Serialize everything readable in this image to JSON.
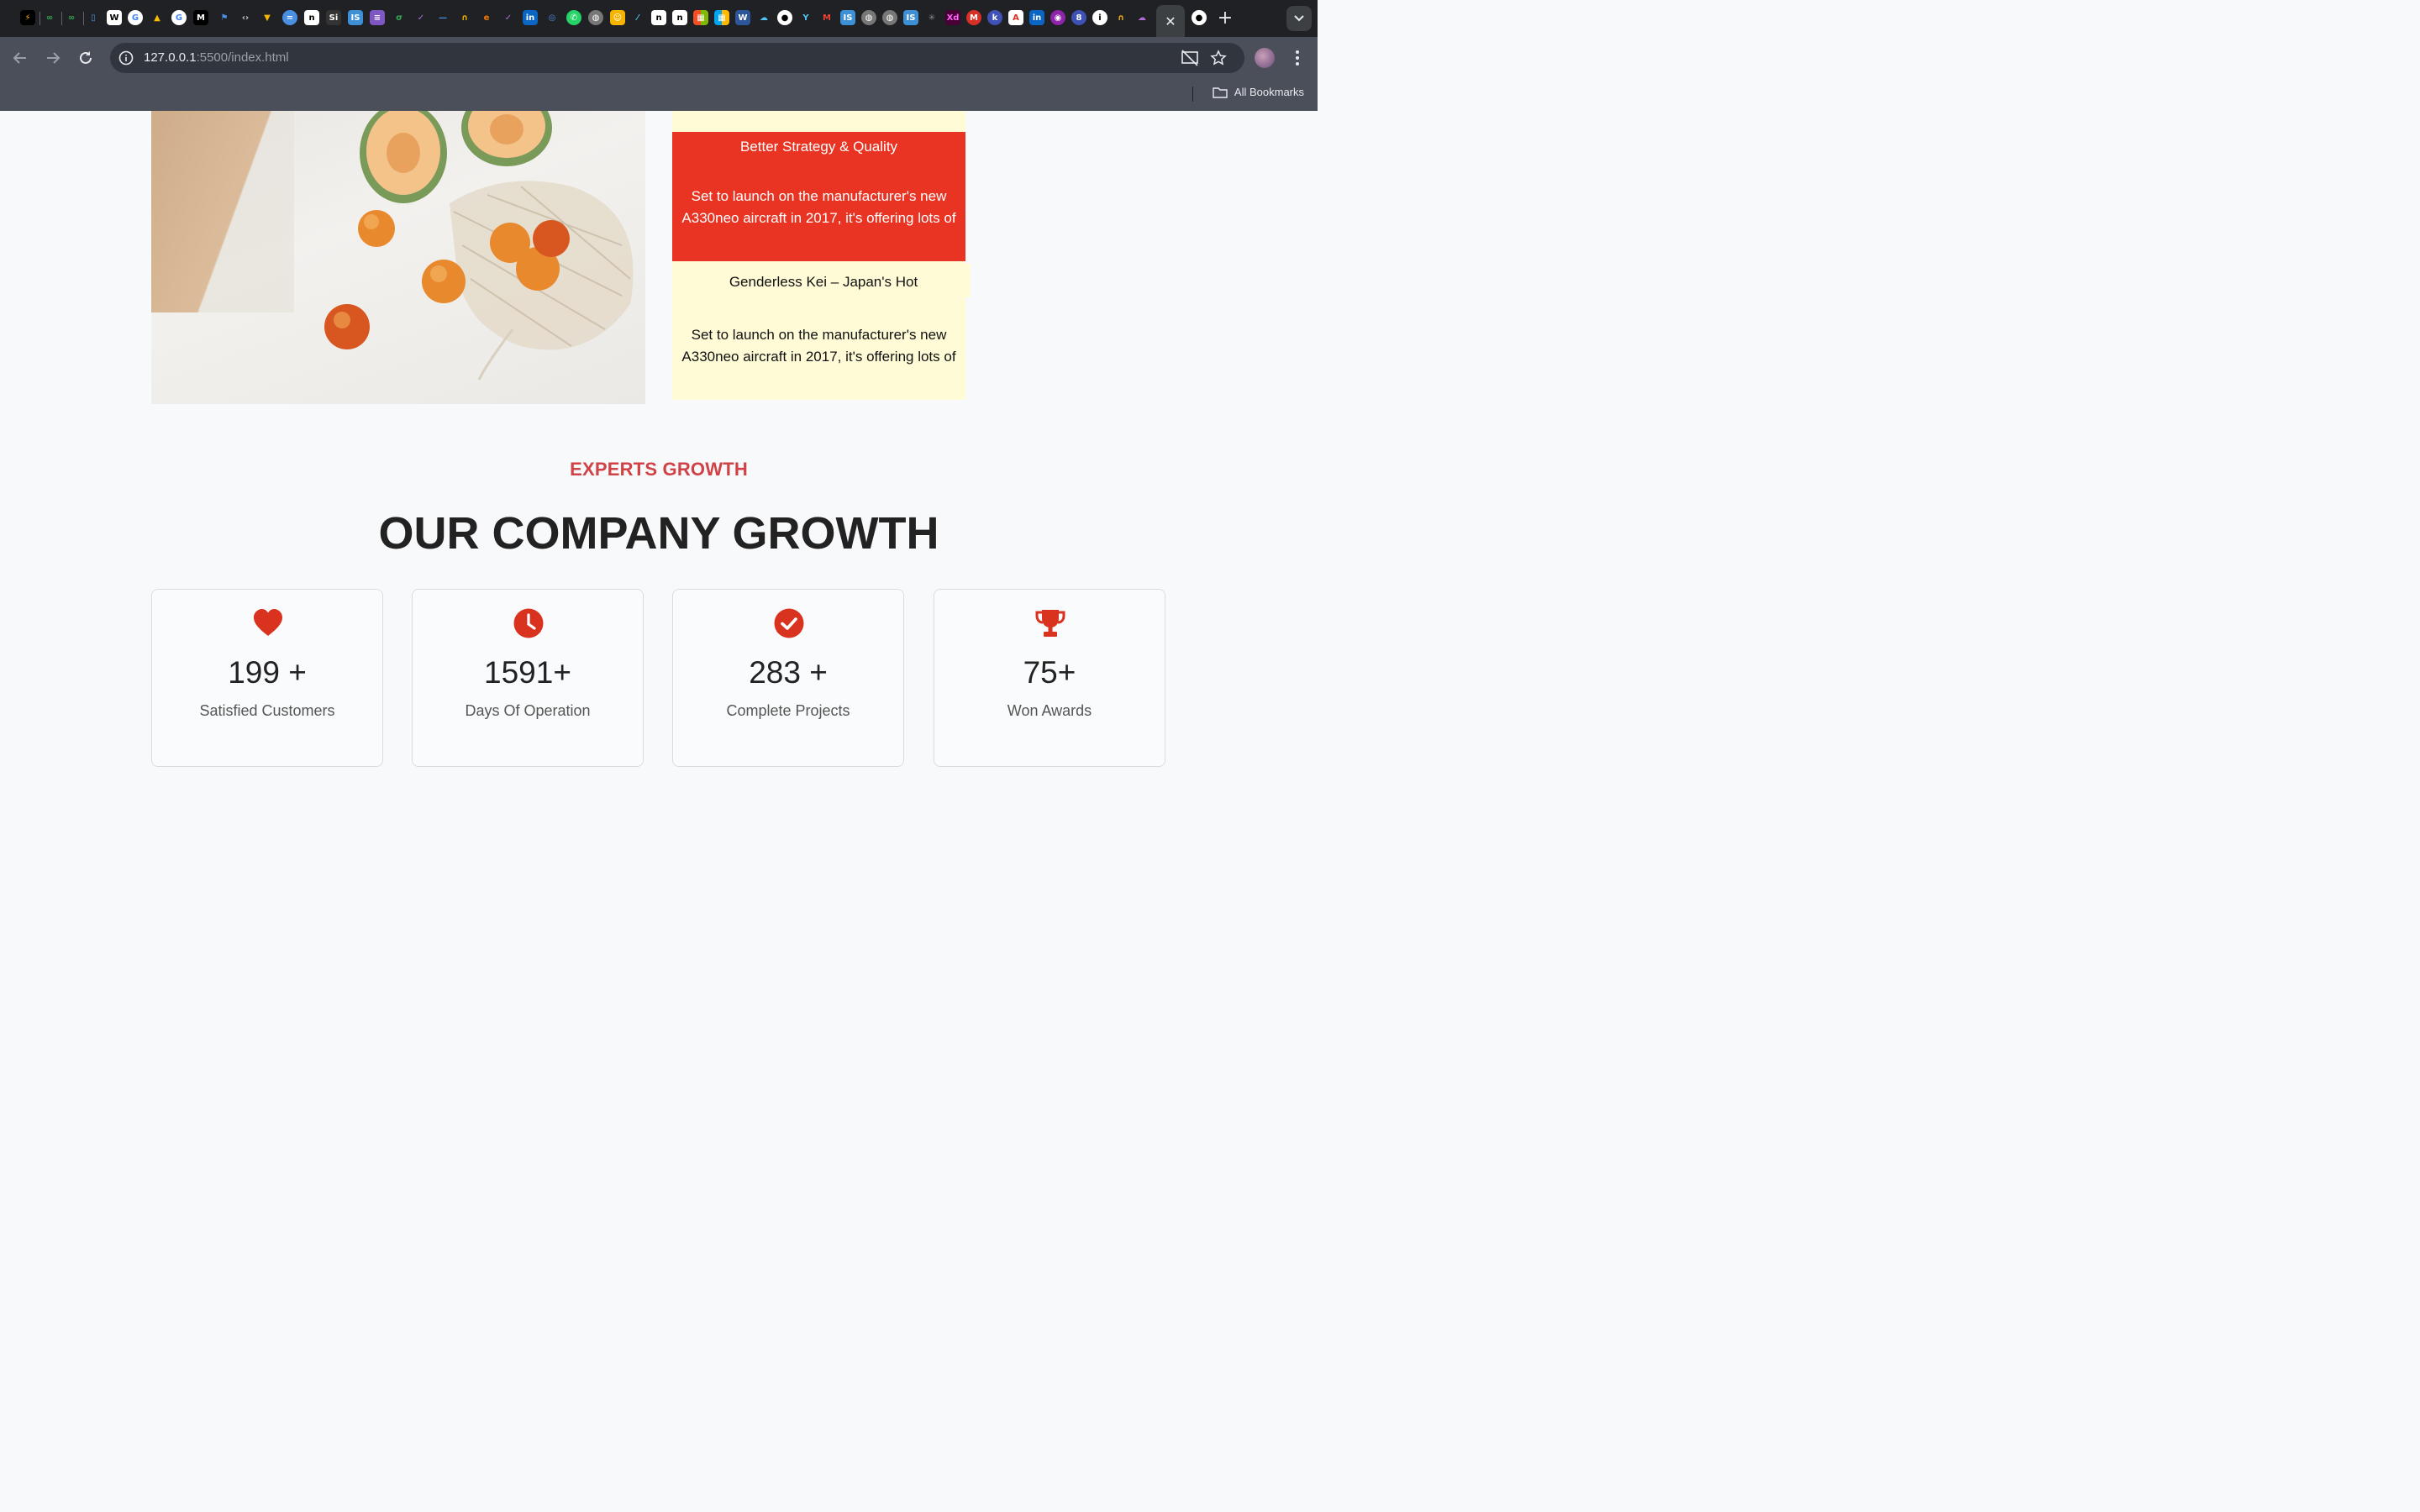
{
  "browser": {
    "url_host": "127.0.0.1",
    "url_rest": ":5500/index.html",
    "bookmarks_label": "All Bookmarks",
    "close_tab_glyph": "✕",
    "new_tab_glyph": "+"
  },
  "cards": {
    "top_title": "",
    "red": {
      "title": "Better Strategy & Quality",
      "body": "Set to launch on the manufacturer's new A330neo aircraft in 2017, it's offering lots of"
    },
    "yellow": {
      "title": "Genderless Kei – Japan's Hot",
      "body": "Set to launch on the manufacturer's new A330neo aircraft in 2017, it's offering lots of"
    }
  },
  "growth": {
    "eyebrow": "EXPERTS GROWTH",
    "headline": "OUR COMPANY GROWTH",
    "accent_color": "#d9321f",
    "stats": [
      {
        "icon": "heart-icon",
        "value": "199 +",
        "label": "Satisfied Customers"
      },
      {
        "icon": "clock-icon",
        "value": "1591+",
        "label": "Days Of Operation"
      },
      {
        "icon": "check-circle-icon",
        "value": "283 +",
        "label": "Complete Projects"
      },
      {
        "icon": "trophy-icon",
        "value": "75+",
        "label": "Won Awards"
      }
    ]
  }
}
